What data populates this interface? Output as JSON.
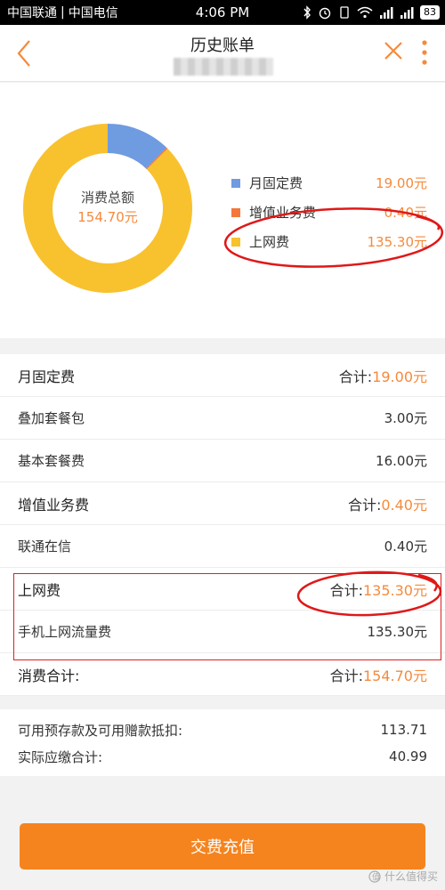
{
  "status_bar": {
    "carrier1": "中国联通",
    "carrier2": "中国电信",
    "time": "4:06 PM",
    "battery": "83"
  },
  "nav": {
    "title": "历史账单",
    "back_icon": "chevron-left-icon",
    "close_icon": "close-icon",
    "more_icon": "more-vertical-icon",
    "accent": "#f58a3c"
  },
  "chart_data": {
    "type": "pie",
    "center_label": "消费总额",
    "center_value": "154.70元",
    "categories": [
      "月固定费",
      "增值业务费",
      "上网费"
    ],
    "values": [
      19.0,
      0.4,
      135.3
    ],
    "colors": [
      "#6f9be0",
      "#f4773a",
      "#f8c12e"
    ]
  },
  "legend": [
    {
      "label": "月固定费",
      "amount": "19.00元",
      "color": "#6f9be0"
    },
    {
      "label": "增值业务费",
      "amount": "0.40元",
      "color": "#f4773a"
    },
    {
      "label": "上网费",
      "amount": "135.30元",
      "color": "#f8c12e"
    }
  ],
  "sections": [
    {
      "title": "月固定费",
      "total_label": "合计:",
      "total": "19.00元",
      "items": [
        {
          "label": "叠加套餐包",
          "amount": "3.00元"
        },
        {
          "label": "基本套餐费",
          "amount": "16.00元"
        }
      ]
    },
    {
      "title": "增值业务费",
      "total_label": "合计:",
      "total": "0.40元",
      "items": [
        {
          "label": "联通在信",
          "amount": "0.40元"
        }
      ]
    },
    {
      "title": "上网费",
      "total_label": "合计:",
      "total": "135.30元",
      "items": [
        {
          "label": "手机上网流量费",
          "amount": "135.30元"
        }
      ]
    }
  ],
  "grand_total": {
    "label": "消费合计:",
    "total_label": "合计:",
    "total": "154.70元"
  },
  "summary": [
    {
      "label": "可用预存款及可用赠款抵扣:",
      "value": "113.71"
    },
    {
      "label": "实际应缴合计:",
      "value": "40.99"
    }
  ],
  "pay_button": "交费充值",
  "watermark": "什么值得买"
}
